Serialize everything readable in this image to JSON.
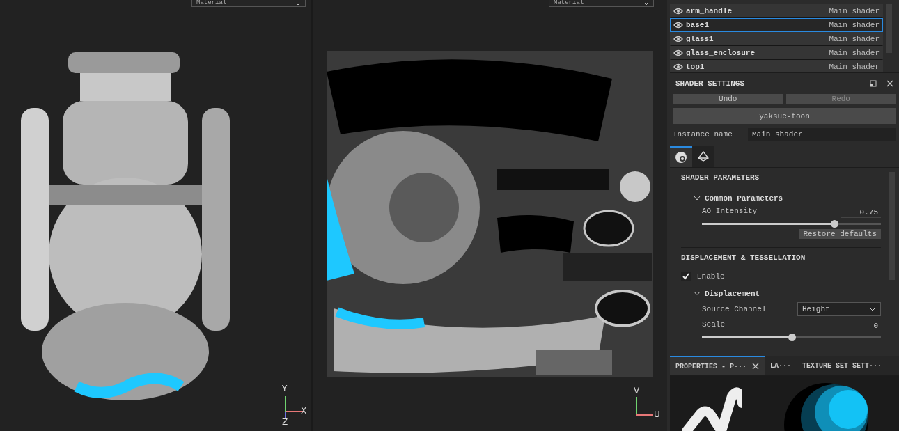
{
  "viewport_3d": {
    "dropdown": "Material",
    "axes": [
      "Y",
      "X",
      "Z"
    ]
  },
  "viewport_uv": {
    "dropdown": "Material",
    "axes": [
      "V",
      "U"
    ]
  },
  "texture_sets": [
    {
      "name": "arm_handle",
      "shader": "Main shader",
      "selected": false
    },
    {
      "name": "base1",
      "shader": "Main shader",
      "selected": true
    },
    {
      "name": "glass1",
      "shader": "Main shader",
      "selected": false
    },
    {
      "name": "glass_enclosure",
      "shader": "Main shader",
      "selected": false
    },
    {
      "name": "top1",
      "shader": "Main shader",
      "selected": false
    }
  ],
  "shader_settings": {
    "title": "SHADER SETTINGS",
    "undo": {
      "label": "Undo",
      "disabled": false
    },
    "redo": {
      "label": "Redo",
      "disabled": true
    },
    "shader_button": "yaksue-toon",
    "instance_name": {
      "label": "Instance name",
      "value": "Main shader"
    },
    "tabs": [
      {
        "kind": "parameters",
        "selected": true
      },
      {
        "kind": "geometry",
        "selected": false
      }
    ],
    "sections": [
      {
        "title": "SHADER PARAMETERS",
        "groups": [
          {
            "title": "Common Parameters",
            "expanded": true,
            "params": [
              {
                "kind": "slider",
                "label": "AO Intensity",
                "reading": "0.75",
                "level": 0.74
              }
            ],
            "button": "Restore defaults"
          }
        ]
      },
      {
        "title": "DISPLACEMENT & TESSELLATION",
        "checkbox": {
          "label": "Enable",
          "checked": true
        },
        "groups": [
          {
            "title": "Displacement",
            "expanded": true,
            "params": [
              {
                "kind": "dropdown",
                "label": "Source Channel",
                "value": "Height"
              },
              {
                "kind": "slider",
                "label": "Scale",
                "reading": "0",
                "level": 0.5
              }
            ]
          }
        ]
      }
    ]
  },
  "dock_tabs": [
    {
      "label": "PROPERTIES - P···",
      "selected": true,
      "closable": true
    },
    {
      "label": "LA···",
      "selected": false,
      "closable": false
    },
    {
      "label": "TEXTURE SET SETT···",
      "selected": false,
      "closable": false
    }
  ]
}
